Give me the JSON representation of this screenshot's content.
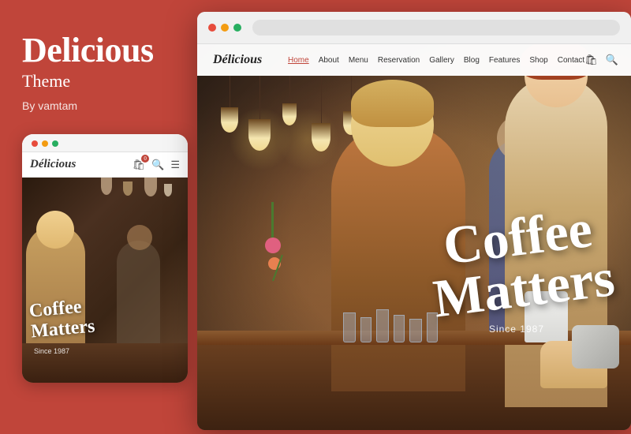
{
  "left": {
    "title": "Delicious",
    "subtitle": "Theme",
    "author": "By vamtam"
  },
  "mobile": {
    "logo": "Délicious",
    "dots": [
      "red",
      "yellow",
      "green"
    ],
    "coffee_line1": "Coffee",
    "coffee_line2": "Matters",
    "since": "Since 1987"
  },
  "desktop": {
    "dots": [
      "red",
      "yellow",
      "green"
    ],
    "nav": {
      "logo": "Délicious",
      "links": [
        "Home",
        "About",
        "Menu",
        "Reservation",
        "Gallery",
        "Blog",
        "Features",
        "Shop",
        "Contact"
      ]
    },
    "hero": {
      "line1": "Coffee",
      "line2": "Matters",
      "since": "Since 1987"
    }
  }
}
